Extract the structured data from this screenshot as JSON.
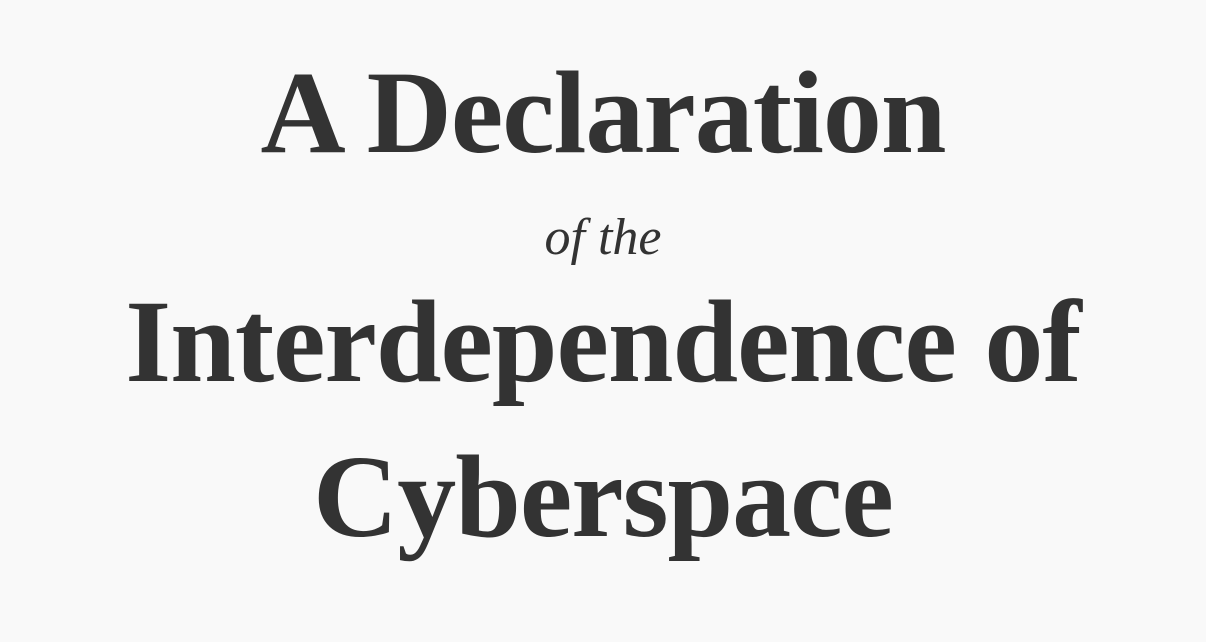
{
  "title": {
    "line1": "A Declaration",
    "line2": "of the",
    "line3": "Interdependence of",
    "line4": "Cyberspace"
  },
  "colors": {
    "background": "#f9f9f9",
    "text": "#333333"
  }
}
